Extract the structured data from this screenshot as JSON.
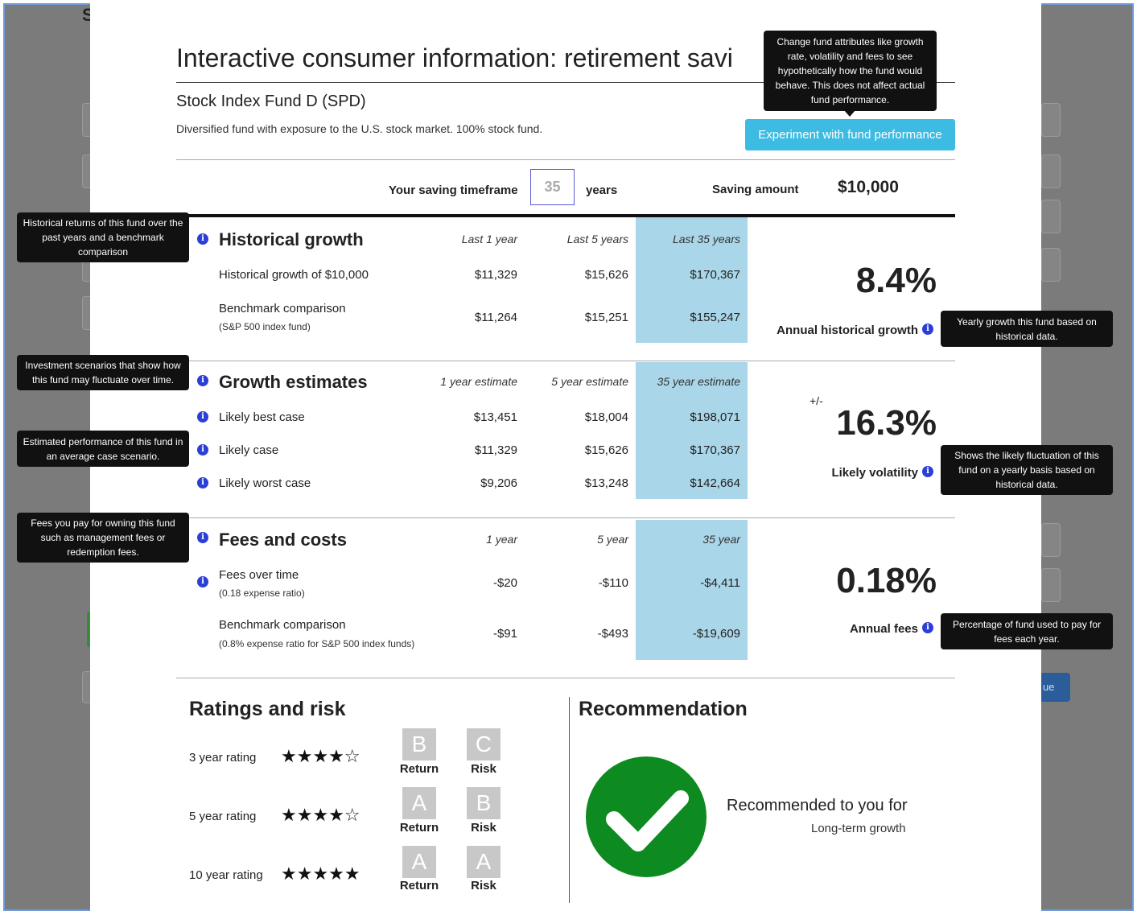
{
  "page": {
    "title": "Interactive consumer information: retirement savi",
    "fund_name": "Stock Index Fund D (SPD)",
    "fund_description": "Diversified fund with exposure to the U.S. stock market. 100% stock fund.",
    "experiment_button": "Experiment with fund performance",
    "experiment_tooltip": "Change fund attributes like growth rate, volatility and fees to see hypothetically how the fund would behave. This does not affect actual fund performance."
  },
  "timeframe": {
    "label": "Your saving timeframe",
    "value": "35",
    "unit": "years",
    "amount_label": "Saving amount",
    "amount": "$10,000"
  },
  "historical": {
    "title": "Historical growth",
    "cols": [
      "Last 1 year",
      "Last 5 years",
      "Last 35 years"
    ],
    "rows": [
      {
        "label": "Historical growth of $10,000",
        "sub": "",
        "values": [
          "$11,329",
          "$15,626",
          "$170,367"
        ]
      },
      {
        "label": "Benchmark comparison",
        "sub": "(S&P 500 index fund)",
        "values": [
          "$11,264",
          "$15,251",
          "$155,247"
        ]
      }
    ],
    "big_value": "8.4%",
    "big_label": "Annual historical growth",
    "tip_left": "Historical returns of this fund over the past years and a benchmark comparison",
    "tip_right": "Yearly growth this fund based on historical data."
  },
  "estimates": {
    "title": "Growth estimates",
    "cols": [
      "1 year estimate",
      "5 year estimate",
      "35 year estimate"
    ],
    "rows": [
      {
        "label": "Likely best case",
        "values": [
          "$13,451",
          "$18,004",
          "$198,071"
        ]
      },
      {
        "label": "Likely case",
        "values": [
          "$11,329",
          "$15,626",
          "$170,367"
        ]
      },
      {
        "label": "Likely worst case",
        "values": [
          "$9,206",
          "$13,248",
          "$142,664"
        ]
      }
    ],
    "plus_minus": "+/-",
    "big_value": "16.3%",
    "big_label": "Likely volatility",
    "tip_left": "Investment scenarios that show how this fund may fluctuate over time.",
    "tip_likely": "Estimated performance of this fund in an average case scenario.",
    "tip_right": "Shows the likely fluctuation of this fund on a yearly basis based on historical data."
  },
  "fees": {
    "title": "Fees and costs",
    "cols": [
      "1 year",
      "5 year",
      "35 year"
    ],
    "rows": [
      {
        "label": "Fees over time",
        "sub": "(0.18 expense ratio)",
        "values": [
          "-$20",
          "-$110",
          "-$4,411"
        ]
      },
      {
        "label": "Benchmark comparison",
        "sub": "(0.8% expense ratio for S&P 500 index funds)",
        "values": [
          "-$91",
          "-$493",
          "-$19,609"
        ]
      }
    ],
    "big_value": "0.18%",
    "big_label": "Annual fees",
    "tip_left": "Fees you pay for owning this fund such as management fees or redemption fees.",
    "tip_right": "Percentage of fund used to pay for fees each year."
  },
  "ratings": {
    "title": "Ratings and risk",
    "return_label": "Return",
    "risk_label": "Risk",
    "rows": [
      {
        "label": "3 year rating",
        "stars": "★★★★☆",
        "stars_count": 4,
        "return": "B",
        "risk": "C"
      },
      {
        "label": "5 year rating",
        "stars": "★★★★☆",
        "stars_count": 4,
        "return": "A",
        "risk": "B"
      },
      {
        "label": "10 year rating",
        "stars": "★★★★★",
        "stars_count": 5,
        "return": "A",
        "risk": "A"
      }
    ]
  },
  "recommendation": {
    "title": "Recommendation",
    "text": "Recommended to you for",
    "sub": "Long-term growth",
    "color": "#0d8a20"
  },
  "background": {
    "button_fragment": "ue"
  },
  "colors": {
    "accent": "#3dbbe2",
    "highlight": "#a9d6e8",
    "info": "#2b3fd6"
  }
}
